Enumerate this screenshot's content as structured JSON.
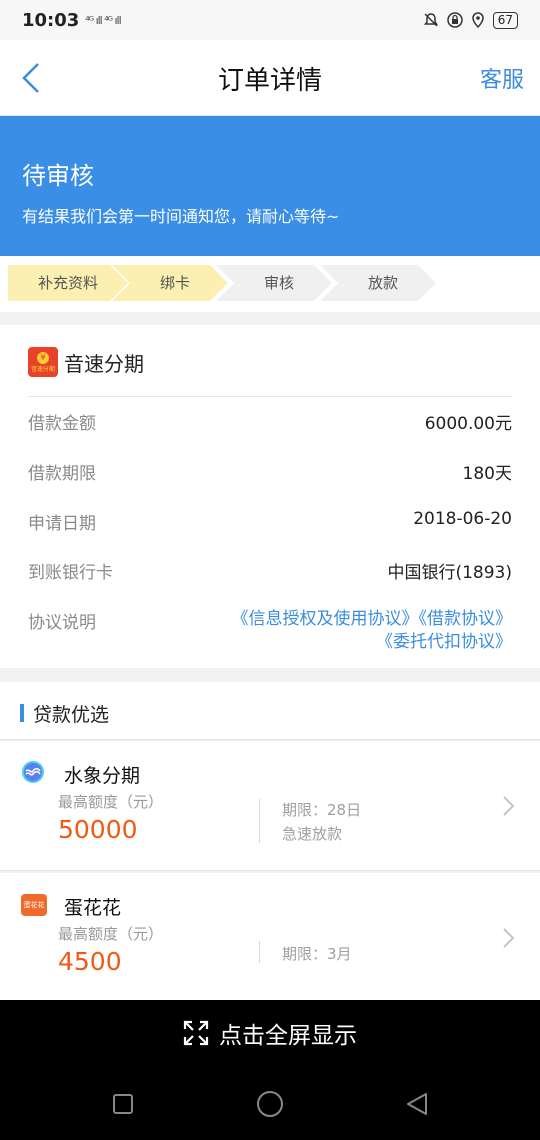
{
  "status_bar": {
    "time": "10:03",
    "signal": "⁴ᴳ ıll ⁴ᴳ ıll",
    "battery": "67"
  },
  "nav": {
    "title": "订单详情",
    "service": "客服"
  },
  "banner": {
    "status": "待审核",
    "message": "有结果我们会第一时间通知您，请耐心等待~"
  },
  "steps": [
    {
      "label": "补充资料",
      "state": "done"
    },
    {
      "label": "绑卡",
      "state": "done"
    },
    {
      "label": "审核",
      "state": "todo"
    },
    {
      "label": "放款",
      "state": "todo"
    }
  ],
  "order": {
    "brand": "音速分期",
    "logo_text": "音速分期",
    "rows": [
      {
        "key": "借款金额",
        "value": "6000.00元"
      },
      {
        "key": "借款期限",
        "value": "180天"
      },
      {
        "key": "申请日期",
        "value": "2018-06-20"
      },
      {
        "key": "到账银行卡",
        "value": "中国银行(1893)"
      }
    ],
    "agreement_label": "协议说明",
    "agreements": [
      "《信息授权及使用协议》",
      "《借款协议》",
      "《委托代扣协议》"
    ]
  },
  "recommend": {
    "title": "贷款优选",
    "products": [
      {
        "name": "水象分期",
        "limit_label": "最高额度（元）",
        "amount": "50000",
        "term": "期限：28日",
        "feature": "急速放款",
        "icon": "shuixiang-logo-icon"
      },
      {
        "name": "蛋花花",
        "limit_label": "最高额度（元）",
        "amount": "4500",
        "term": "期限：3月",
        "feature": "",
        "icon": "danhuahua-logo-icon",
        "logo_text": "蛋花花"
      }
    ]
  },
  "bottom": {
    "fullscreen": "点击全屏显示"
  },
  "colors": {
    "accent": "#3a8ee6",
    "step_active": "#fbf0b2",
    "amount": "#f05a14"
  }
}
